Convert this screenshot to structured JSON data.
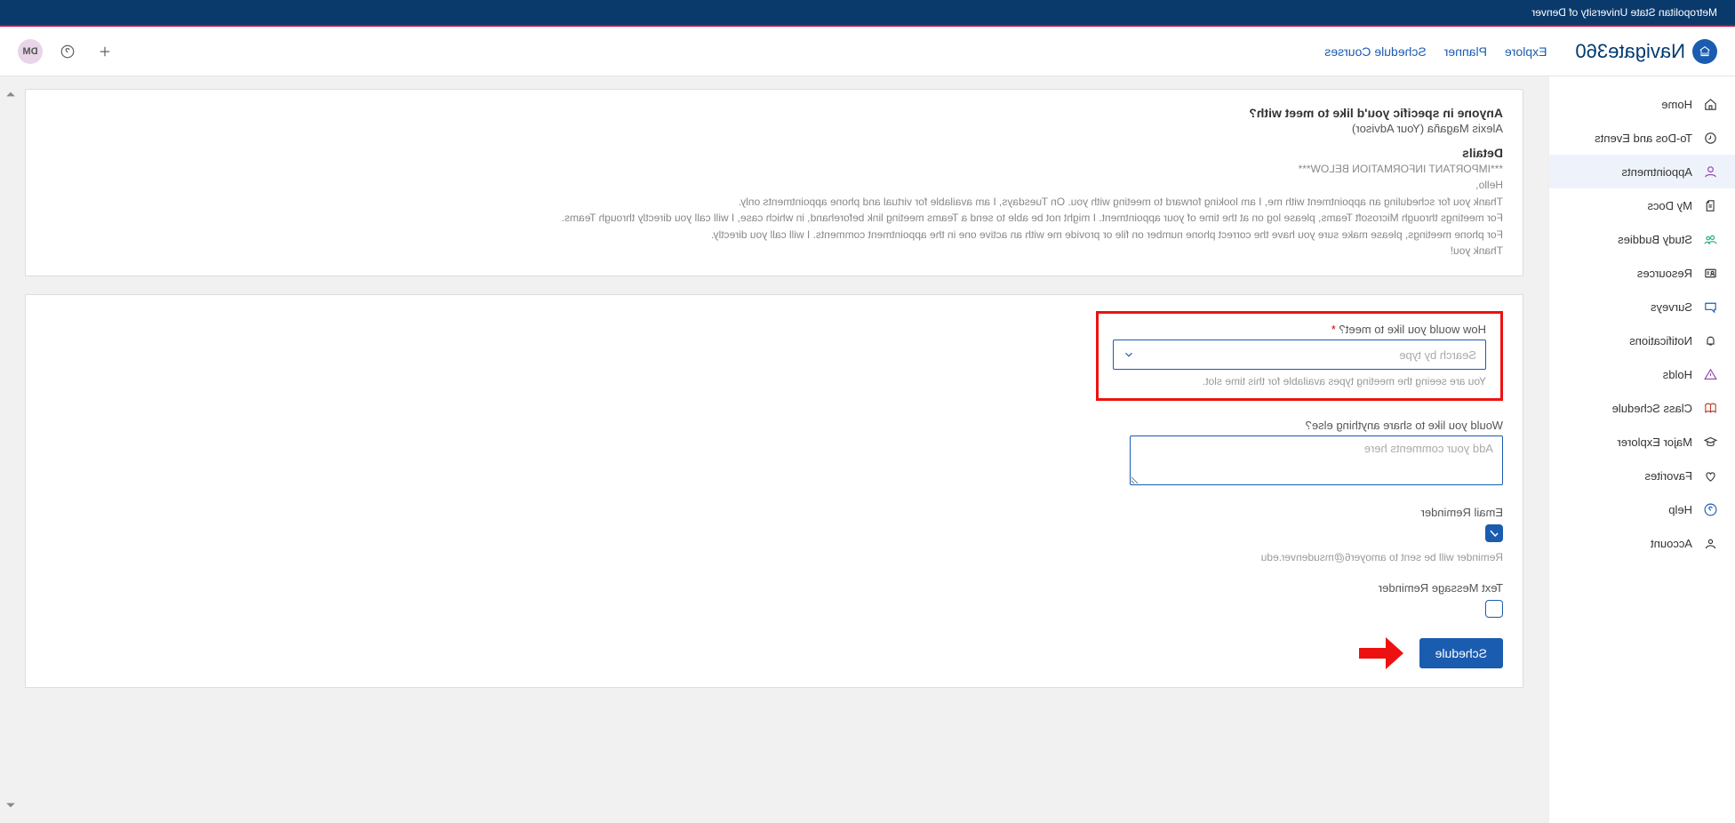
{
  "topbar": {
    "org_name": "Metropolitan State University of Denver"
  },
  "brand": {
    "name_part1": "Navigate",
    "name_part2": "360"
  },
  "nav": {
    "explore": "Explore",
    "planner": "Planner",
    "schedule_courses": "Schedule Courses"
  },
  "header": {
    "avatar_initials": "DM"
  },
  "sidebar": {
    "items": [
      {
        "label": "Home"
      },
      {
        "label": "To-Dos and Events"
      },
      {
        "label": "Appointments"
      },
      {
        "label": "My Docs"
      },
      {
        "label": "Study Buddies"
      },
      {
        "label": "Resources"
      },
      {
        "label": "Surveys"
      },
      {
        "label": "Notifications"
      },
      {
        "label": "Holds"
      },
      {
        "label": "Class Schedule"
      },
      {
        "label": "Major Explorer"
      },
      {
        "label": "Favorites"
      },
      {
        "label": "Help"
      },
      {
        "label": "Account"
      }
    ]
  },
  "card1": {
    "title": "Anyone in specific you'd like to meet with?",
    "subtitle": "Alexis Magaña (Your Advisor)",
    "details_title": "Details",
    "details_important": "***IMPORTANT INFORMATION BELOW***",
    "details_hello": "Hello,",
    "details_line1": "Thank you for scheduling an appointment with me, I am looking forward to meeting with you. On Tuesdays, I am available for virtual and phone appointments only.",
    "details_line2": "For meetings through Microsoft Teams, please log on at the time of your appointment. I might not be able to send a Teams meeting link beforehand, in which case, I will call you directly through Teams.",
    "details_line3": "For phone meetings, please make sure you have the correct phone number on file or provide me with an active one in the appointment comments. I will call you directly.",
    "details_thank": "Thank you!"
  },
  "form": {
    "meet_label": "How would you like to meet?",
    "meet_placeholder": "Search by type",
    "meet_hint": "You are seeing the meeting types available for this time slot.",
    "share_label": "Would you like to share anything else?",
    "share_placeholder": "Add your comments here",
    "email_reminder_label": "Email Reminder",
    "email_reminder_hint": "Reminder will be sent to amoyer6@msudenver.edu",
    "text_reminder_label": "Text Message Reminder",
    "schedule_button": "Schedule"
  }
}
